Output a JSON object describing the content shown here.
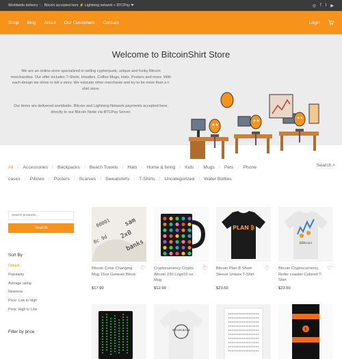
{
  "topbar": {
    "notice": "Worldwide delivery 📞 Bitcoin accepted here ⚡ Lightning network + BTCPay ❤",
    "socials": [
      "instagram-icon",
      "facebook-icon",
      "twitter-icon",
      "youtube-icon"
    ]
  },
  "nav": {
    "links": [
      "Shop",
      "Blog",
      "About",
      "Our Customers",
      "Contact"
    ],
    "login": "Login",
    "cart_icon": "cart-icon"
  },
  "hero": {
    "title": "Welcome to BitcoinShirt Store",
    "paragraph1": "We are an online-store specialized in selling cypherpunk, unique and funky Bitcoin merchandise. Our offer includes T-Shirts, Hoodies, Coffee Mugs, Hats, Posters and more. With each design we strive to tell a story. We educate other merchants and try to be more than a t-shirt store.",
    "paragraph2": "Our items are delivered worldwide. Bitcoin and Lightning Network payments accepted here, directly to our Bitcoin Node via BTCPay Server."
  },
  "categories": [
    "All",
    "Accessories",
    "Backpacks",
    "Beach Towels",
    "Hats",
    "Home & living",
    "Kids",
    "Mugs",
    "Pets",
    "Phone cases",
    "Pillows",
    "Posters",
    "Scarves",
    "Sweatshirts",
    "T-Shirts",
    "Uncategorized",
    "Water Bottles"
  ],
  "search_link": "Search",
  "sidebar": {
    "search_placeholder": "Search products...",
    "search_button": "Search",
    "sort_title": "Sort By",
    "sort_options": [
      "Default",
      "Popularity",
      "Average rating",
      "Newness",
      "Price: Low to High",
      "Price: High to Low"
    ],
    "filter_title": "Filter by price"
  },
  "products": [
    {
      "name": "Bitcoin Color Changing Mug 15oz Genesis Block",
      "price": "$17.90"
    },
    {
      "name": "Cryptocurrency Crypto Altcoin 230 Logo15 oz. Mug",
      "price": "$12.99"
    },
    {
      "name": "Bitcoin Plan B Short-Sleeve Unisex T-Shirt",
      "price": "$23.50"
    },
    {
      "name": "Bitcoin Cryptocurrency Roller coaster Colored T-Shirt",
      "price": "$23.50"
    },
    {
      "name": "",
      "price": ""
    },
    {
      "name": "",
      "price": ""
    },
    {
      "name": "",
      "price": ""
    },
    {
      "name": "",
      "price": ""
    }
  ],
  "product_images": {
    "plan_b_text": "PLAN ₿",
    "roller_label": "₿Bitcoin",
    "tshirt2_text": "BITCOIN BLOCK",
    "bitcoin_symbol": "₿"
  },
  "colors": {
    "accent": "#f7931a",
    "topbar": "#3b3b3b",
    "hero_bg": "#ececec"
  }
}
